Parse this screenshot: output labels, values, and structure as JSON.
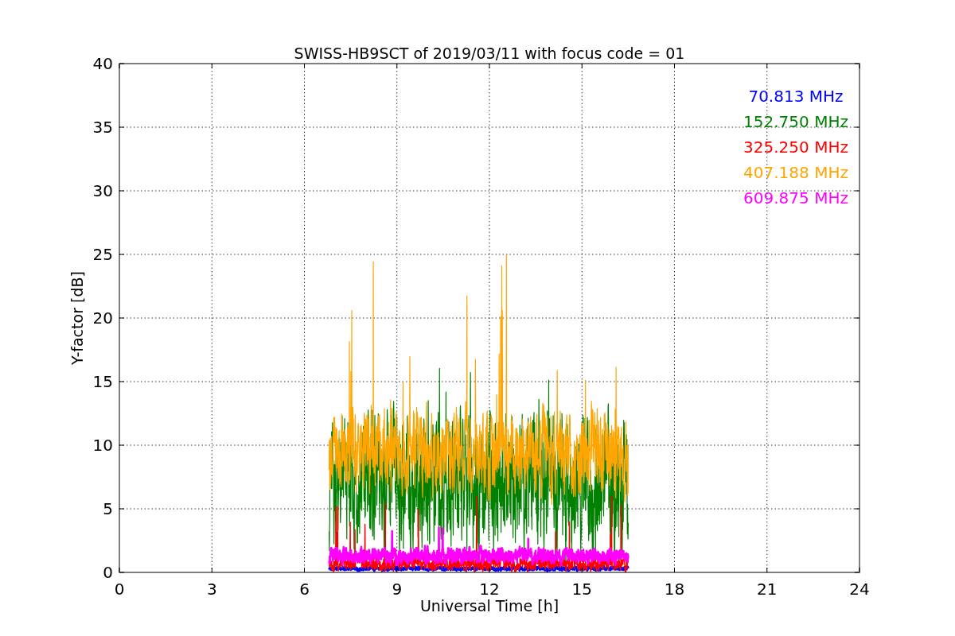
{
  "figure": {
    "title": "SWISS-HB9SCT of 2019/03/11 with focus code = 01",
    "xlabel": "Universal Time [h]",
    "ylabel": "Y-factor [dB]",
    "xticks": [
      "0",
      "3",
      "6",
      "9",
      "12",
      "15",
      "18",
      "21",
      "24"
    ],
    "yticks": [
      "40",
      "35",
      "30",
      "25",
      "20",
      "15",
      "10",
      "5",
      "0"
    ],
    "legend": [
      {
        "label": "70.813 MHz",
        "color": "#0000ff"
      },
      {
        "label": "152.750 MHz",
        "color": "#008000"
      },
      {
        "label": "325.250 MHz",
        "color": "#ff0000"
      },
      {
        "label": "407.188 MHz",
        "color": "#ffa500"
      },
      {
        "label": "609.875 MHz",
        "color": "#ff00ff"
      }
    ]
  }
}
